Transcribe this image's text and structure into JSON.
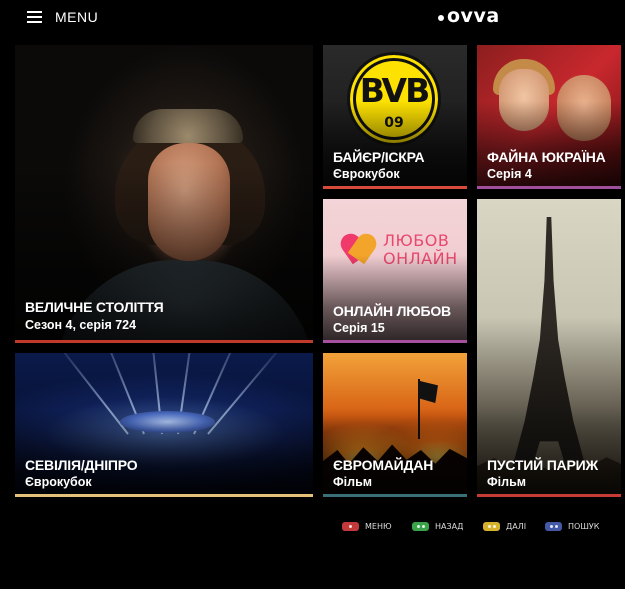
{
  "header": {
    "menu_label": "MENU",
    "logo_text": "ovva"
  },
  "tiles": [
    {
      "title": "ВЕЛИЧНЕ СТОЛІТТЯ",
      "subtitle": "Сезон 4, серія 724",
      "accent": "#c0392b"
    },
    {
      "title": "СЕВІЛІЯ/ДНІПРО",
      "subtitle": "Єврокубок",
      "accent": "#e5c07b"
    },
    {
      "title": "БАЙЄР/ІСКРА",
      "subtitle": "Єврокубок",
      "accent": "#d84b3a"
    },
    {
      "title": "ФАЙНА ЮКРАЇНА",
      "subtitle": "Серія 4",
      "accent": "#a04f9b"
    },
    {
      "title": "ОНЛАЙН ЛЮБОВ",
      "subtitle": "Серія 15",
      "accent": "#a64f9f"
    },
    {
      "title": "ЄВРОМАЙДАН",
      "subtitle": "Фільм",
      "accent": "#3b6f77"
    },
    {
      "title": "ПУСТИЙ ПАРИЖ",
      "subtitle": "Фільм",
      "accent": "#c63b36"
    }
  ],
  "art": {
    "bvb_letters": "BVB",
    "bvb_number": "09",
    "love_brand_line1": "ЛЮБОВ",
    "love_brand_line2": "ОНЛАЙН"
  },
  "legend": [
    {
      "label": "МЕНЮ",
      "color": "#c43a3a",
      "icon": "red-key-icon"
    },
    {
      "label": "НАЗАД",
      "color": "#3aa34a",
      "icon": "green-key-icon"
    },
    {
      "label": "ДАЛІ",
      "color": "#d6b22c",
      "icon": "yellow-key-icon"
    },
    {
      "label": "ПОШУК",
      "color": "#4458a8",
      "icon": "blue-key-icon"
    }
  ]
}
